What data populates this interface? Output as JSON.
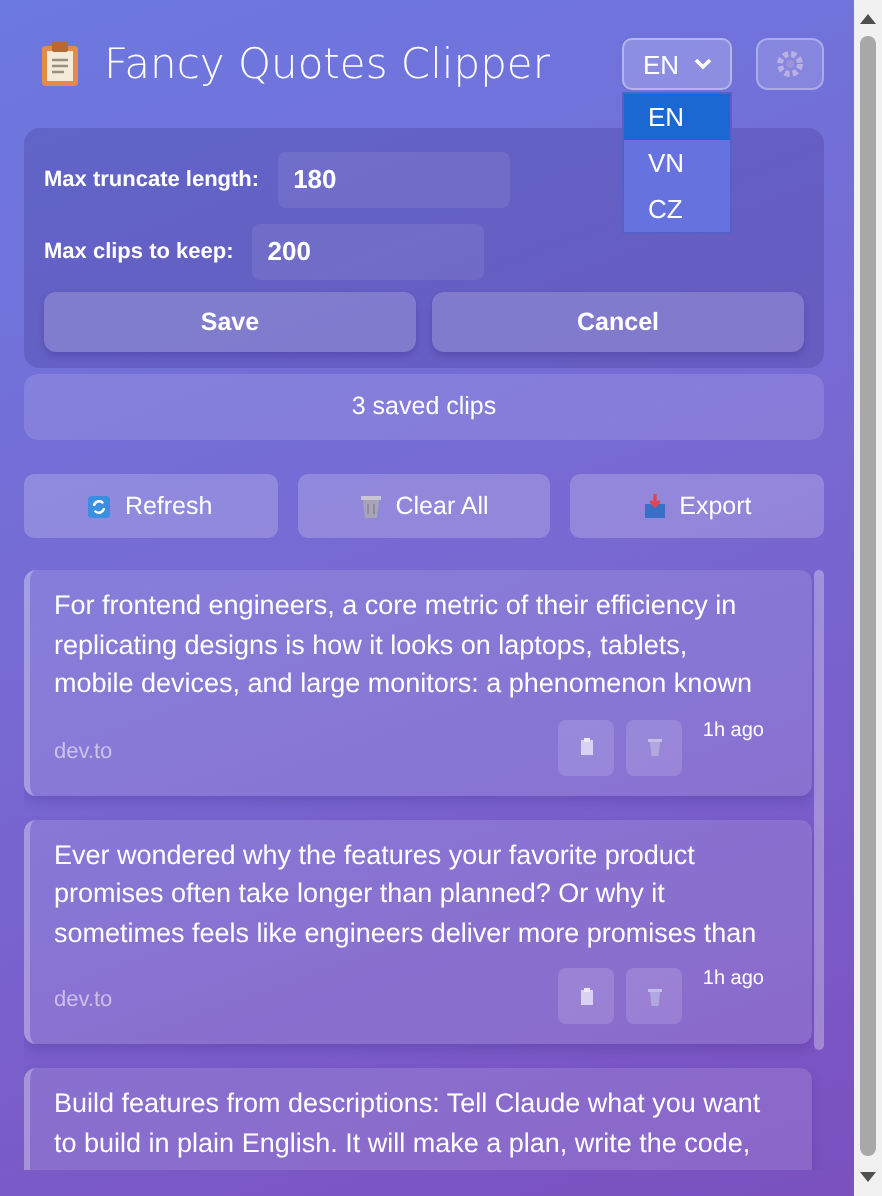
{
  "header": {
    "title": "Fancy Quotes Clipper"
  },
  "language": {
    "value": "EN",
    "open": true,
    "options": [
      {
        "label": "EN",
        "selected": true
      },
      {
        "label": "VN",
        "selected": false
      },
      {
        "label": "CZ",
        "selected": false
      }
    ]
  },
  "settings": {
    "fields": [
      {
        "label": "Max truncate length:",
        "value": "180"
      },
      {
        "label": "Max clips to keep:",
        "value": "200"
      }
    ],
    "buttons": [
      "Save",
      "Cancel"
    ]
  },
  "count": "3 saved clips",
  "actions": [
    {
      "kind": "refresh",
      "label": "Refresh"
    },
    {
      "kind": "clear",
      "label": "Clear All"
    },
    {
      "kind": "export",
      "label": "Export"
    }
  ],
  "clips": [
    {
      "text": "For frontend engineers, a core metric of their efficiency in replicating designs is how it looks on laptops, tablets, mobile devices, and large monitors: a phenomenon known",
      "source": "dev.to",
      "time": "1h ago"
    },
    {
      "text": "Ever wondered why the features your favorite product promises often take longer than planned? Or why it sometimes feels like engineers deliver more promises than",
      "source": "dev.to",
      "time": "1h ago"
    },
    {
      "text": "Build features from descriptions: Tell Claude what you want to build in plain English. It will make a plan, write the code,"
    }
  ]
}
